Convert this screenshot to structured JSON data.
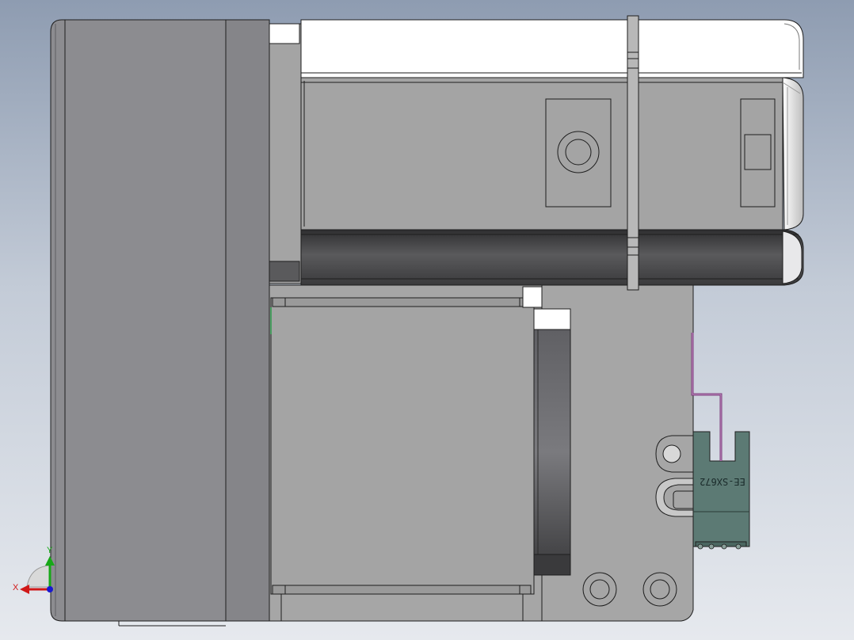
{
  "viewport": {
    "background_top": "#8e9cb1",
    "background_bottom": "#e6e9ee"
  },
  "model": {
    "sensor_label": "EE-SX672",
    "part_colors": {
      "housing": "#8e8e92",
      "plate": "#a4a4a4",
      "cover": "#ffffff",
      "channel": "#4a4a4c",
      "sensor": "#5c7a74",
      "wire": "#7a3a7a"
    }
  },
  "triad": {
    "x_label": "X",
    "y_label": "Y",
    "x_color": "#d01818",
    "y_color": "#18a818",
    "z_color": "#1818d0"
  }
}
